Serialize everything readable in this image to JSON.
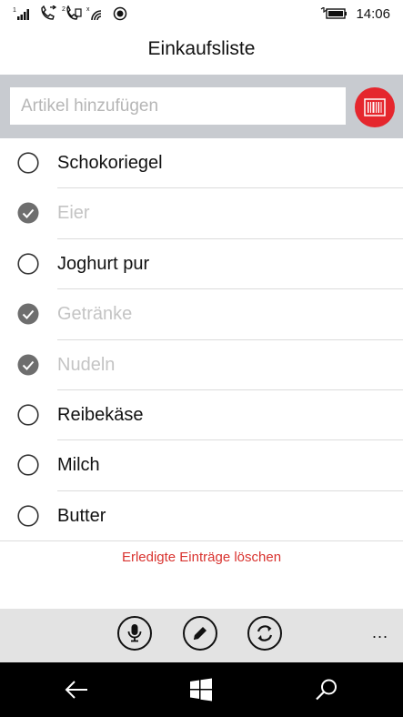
{
  "status_bar": {
    "time": "14:06",
    "icons": [
      "signal-icon",
      "call-forward-icon",
      "sim2-icon",
      "wifi-icon",
      "record-icon",
      "battery-icon"
    ]
  },
  "header": {
    "title": "Einkaufsliste"
  },
  "add_bar": {
    "placeholder": "Artikel hinzufügen",
    "scan_icon": "barcode-icon"
  },
  "items": [
    {
      "label": "Schokoriegel",
      "checked": false
    },
    {
      "label": "Eier",
      "checked": true
    },
    {
      "label": "Joghurt pur",
      "checked": false
    },
    {
      "label": "Getränke",
      "checked": true
    },
    {
      "label": "Nudeln",
      "checked": true
    },
    {
      "label": "Reibekäse",
      "checked": false
    },
    {
      "label": "Milch",
      "checked": false
    },
    {
      "label": "Butter",
      "checked": false
    }
  ],
  "clear_done_label": "Erledigte Einträge löschen",
  "app_bar": {
    "buttons": [
      "microphone-icon",
      "pencil-icon",
      "sync-icon"
    ],
    "more_label": "..."
  },
  "nav_bar": {
    "buttons": [
      "back-arrow-icon",
      "windows-icon",
      "search-icon"
    ]
  },
  "colors": {
    "accent": "#e5262d",
    "clear_text": "#d9332f",
    "checked_circle": "#6e6e6e",
    "done_text": "#c4c4c4"
  }
}
